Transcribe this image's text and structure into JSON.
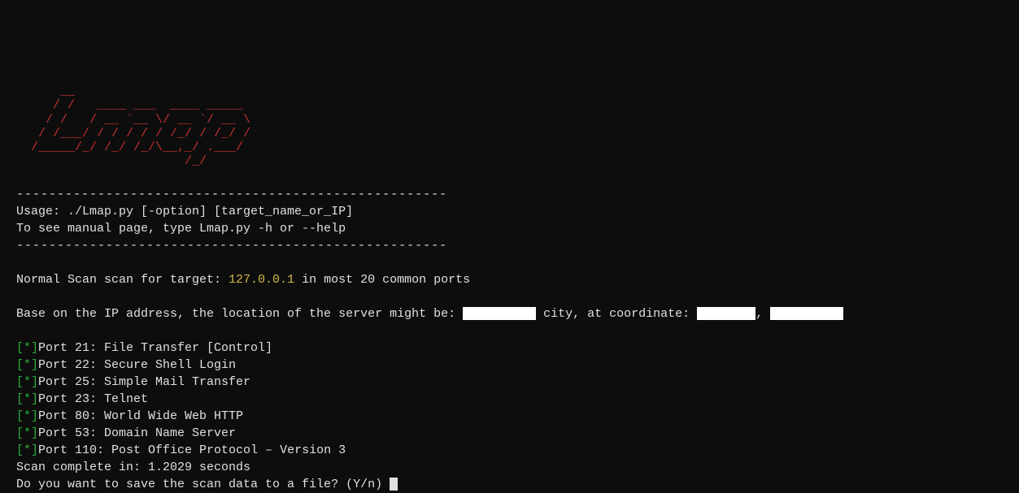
{
  "ascii_logo": {
    "l1": "      __                              ",
    "l2": "     / /   ____ ___  ____ _____       ",
    "l3": "    / /   / __ `__ \\/ __ `/ __ \\    ",
    "l4": "   / /___/ / / / / / /_/ / /_/ /      ",
    "l5": "  /_____/_/ /_/ /_/\\__,_/ .___/      ",
    "l6": "                       /_/            "
  },
  "divider": "-----------------------------------------------------",
  "usage": "Usage: ./Lmap.py [-option] [target_name_or_IP]",
  "manual": "To see manual page, type Lmap.py -h or --help",
  "scan_prefix": "Normal Scan scan for target: ",
  "target_ip": "127.0.0.1",
  "scan_suffix": " in most 20 common ports",
  "location_prefix": "Base on the IP address, the location of the server might be: ",
  "location_mid1": " city, at coordinate: ",
  "location_mid2": ", ",
  "star": "[*]",
  "ports": [
    {
      "text": "Port 21: File Transfer [Control]"
    },
    {
      "text": "Port 22: Secure Shell Login"
    },
    {
      "text": "Port 25: Simple Mail Transfer"
    },
    {
      "text": "Port 23: Telnet"
    },
    {
      "text": "Port 80: World Wide Web HTTP"
    },
    {
      "text": "Port 53: Domain Name Server"
    },
    {
      "text": "Port 110: Post Office Protocol – Version 3"
    }
  ],
  "scan_complete": "Scan complete in: 1.2029 seconds",
  "save_prompt": "Do you want to save the scan data to a file? (Y/n) "
}
